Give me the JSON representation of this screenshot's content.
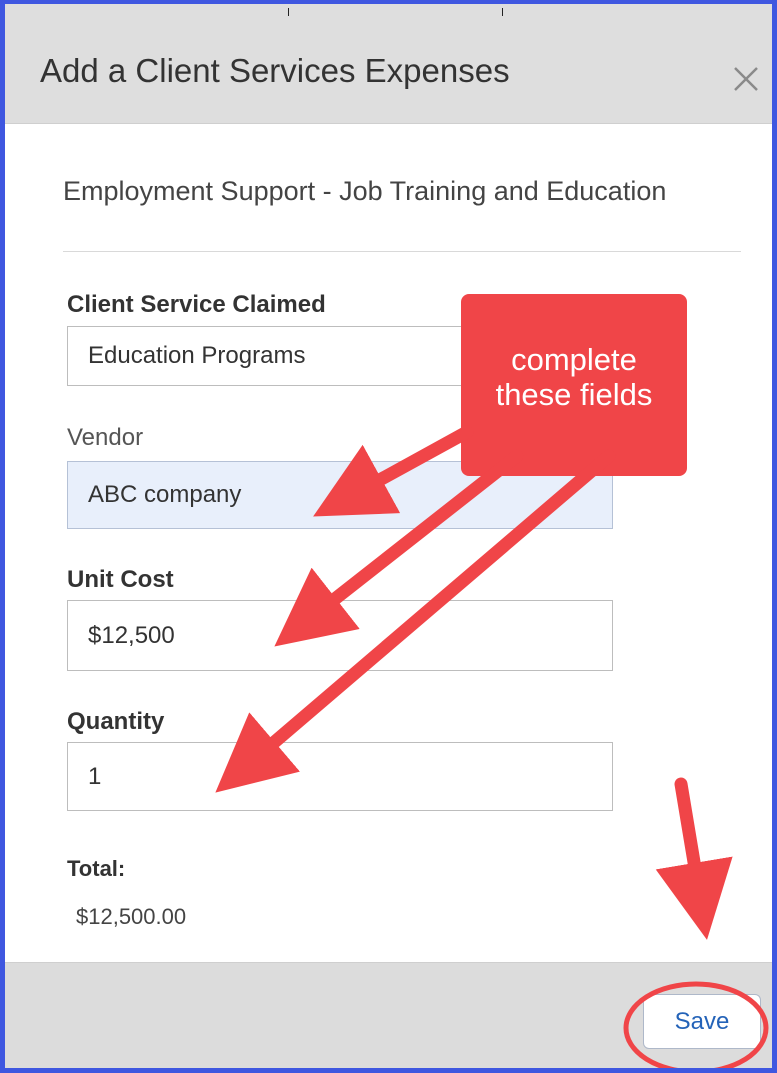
{
  "dialog": {
    "title": "Add a Client Services Expenses",
    "close_icon": "close-icon",
    "section_title": "Employment Support - Job Training and Education"
  },
  "form": {
    "client_service": {
      "label": "Client Service Claimed",
      "value": "Education Programs"
    },
    "vendor": {
      "label": "Vendor",
      "value": "ABC company"
    },
    "unit_cost": {
      "label": "Unit Cost",
      "value": "$12,500"
    },
    "quantity": {
      "label": "Quantity",
      "value": "1"
    },
    "total": {
      "label": "Total:",
      "value": "$12,500.00"
    }
  },
  "footer": {
    "save_label": "Save"
  },
  "annotation": {
    "text_line1": "complete",
    "text_line2": "these fields",
    "color": "#f04548"
  },
  "colors": {
    "header_bg": "#dedede",
    "frame_border": "#3f57e0",
    "vendor_bg": "#e8effb",
    "save_text": "#2463b8"
  }
}
